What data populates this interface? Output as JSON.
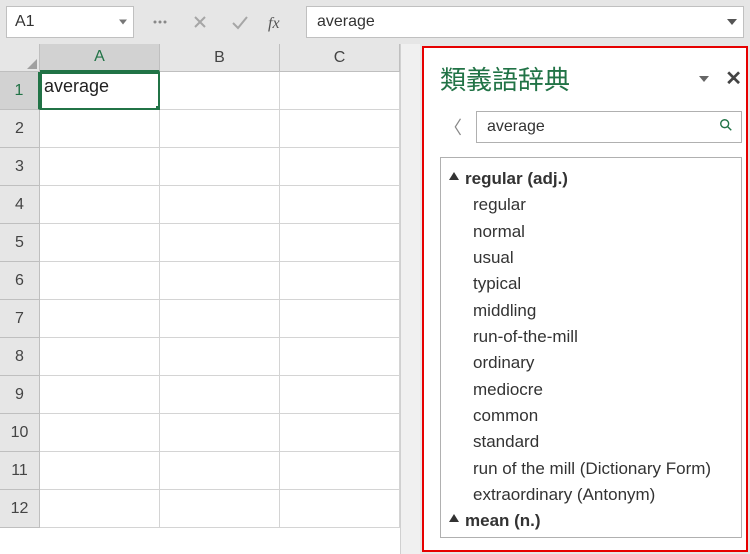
{
  "nameBox": {
    "value": "A1"
  },
  "formula": {
    "value": "average"
  },
  "columns": [
    "A",
    "B",
    "C"
  ],
  "activeColIndex": 0,
  "rows": [
    1,
    2,
    3,
    4,
    5,
    6,
    7,
    8,
    9,
    10,
    11,
    12
  ],
  "activeRowIndex": 0,
  "cells": {
    "A1": "average"
  },
  "thesaurus": {
    "title": "類義語辞典",
    "searchValue": "average",
    "groups": [
      {
        "head": "regular (adj.)",
        "items": [
          "regular",
          "normal",
          "usual",
          "typical",
          "middling",
          "run-of-the-mill",
          "ordinary",
          "mediocre",
          "common",
          "standard",
          "run of the mill (Dictionary Form)",
          "extraordinary (Antonym)"
        ]
      },
      {
        "head": "mean (n.)",
        "items": []
      }
    ]
  }
}
